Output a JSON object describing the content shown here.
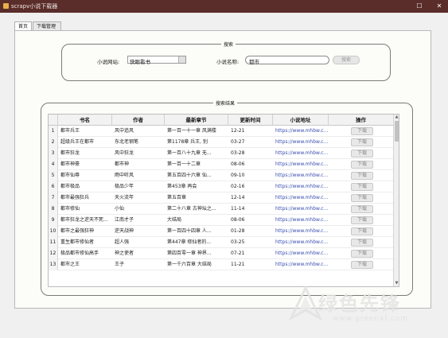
{
  "window": {
    "title": "scrapv小说下载器",
    "controls": {
      "maximize_glyph": "☐",
      "close_glyph": "✕"
    }
  },
  "tabs": [
    {
      "label": "首页",
      "active": true
    },
    {
      "label": "下载管理",
      "active": false
    }
  ],
  "search_group": {
    "legend": "搜索",
    "source_label": "小说网站:",
    "source_value": "快眼看书",
    "keyword_label": "小说名称:",
    "keyword_value": "都市",
    "search_button": "搜索"
  },
  "results_group": {
    "legend": "搜索结果",
    "columns": [
      "",
      "书名",
      "作者",
      "最新章节",
      "更新时间",
      "小说地址",
      "操作"
    ],
    "rows": [
      {
        "n": "1",
        "title": "都市兵王",
        "author": "风中追风",
        "chapter": "第一百一十一章 风满楼",
        "time": "12-21",
        "url": "https://www.mhbw.c...",
        "action": "下载"
      },
      {
        "n": "2",
        "title": "超级兵王在都市",
        "author": "东北老钢笔",
        "chapter": "第1178章 兵王, 别",
        "time": "03-27",
        "url": "https://www.mhbw.c...",
        "action": "下载"
      },
      {
        "n": "3",
        "title": "都市狂龙",
        "author": "风中狂龙",
        "chapter": "第一百八十九章 无...",
        "time": "03-28",
        "url": "https://www.mhbw.c...",
        "action": "下载"
      },
      {
        "n": "4",
        "title": "都市神豪",
        "author": "都市神",
        "chapter": "第一百一十二章",
        "time": "08-06",
        "url": "https://www.mhbw.c...",
        "action": "下载"
      },
      {
        "n": "5",
        "title": "都市仙尊",
        "author": "雨中听风",
        "chapter": "第五百四十六章 仙...",
        "time": "09-10",
        "url": "https://www.mhbw.c...",
        "action": "下载"
      },
      {
        "n": "6",
        "title": "都市极品",
        "author": "极品少年",
        "chapter": "第453章 再会",
        "time": "02-16",
        "url": "https://www.mhbw.c...",
        "action": "下载"
      },
      {
        "n": "7",
        "title": "都市最强狂兵",
        "author": "天火流年",
        "chapter": "第五百章",
        "time": "12-14",
        "url": "https://www.mhbw.c...",
        "action": "下载"
      },
      {
        "n": "8",
        "title": "都市修仙",
        "author": "小仙",
        "chapter": "第二十八章 古神坛之...",
        "time": "11-14",
        "url": "https://www.mhbw.c...",
        "action": "下载"
      },
      {
        "n": "9",
        "title": "都市狂龙之逆天不死...",
        "author": "江南才子",
        "chapter": "大结局",
        "time": "08-06",
        "url": "https://www.mhbw.c...",
        "action": "下载"
      },
      {
        "n": "10",
        "title": "都市之最强狂神",
        "author": "逆天战神",
        "chapter": "第一百四十四章 人...",
        "time": "01-28",
        "url": "https://www.mhbw.c...",
        "action": "下载"
      },
      {
        "n": "11",
        "title": "重生都市修仙者",
        "author": "超人强",
        "chapter": "第447章 修仙者的...",
        "time": "03-25",
        "url": "https://www.mhbw.c...",
        "action": "下载"
      },
      {
        "n": "12",
        "title": "极品都市修仙高手",
        "author": "神之使者",
        "chapter": "第四百零一章 神界...",
        "time": "07-21",
        "url": "https://www.mhbw.c...",
        "action": "下载"
      },
      {
        "n": "13",
        "title": "都市之王",
        "author": "王子",
        "chapter": "第一千六百章 大结局",
        "time": "11-21",
        "url": "https://www.mhbw.c...",
        "action": "下载"
      }
    ]
  },
  "watermark": {
    "main": "绿色先锋",
    "sub": "www.greenxf.com"
  }
}
